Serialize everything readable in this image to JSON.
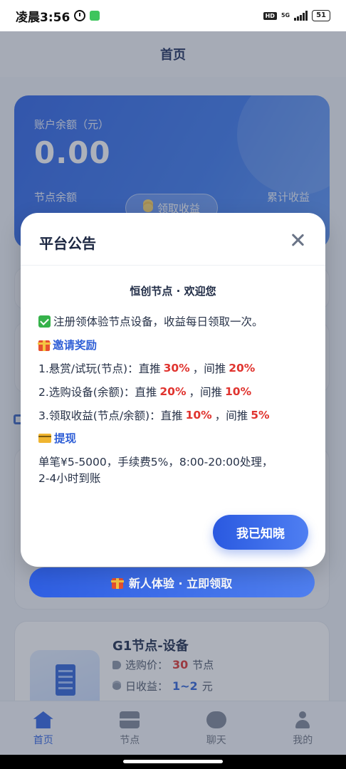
{
  "status_bar": {
    "time": "凌晨3:56",
    "hd": "HD",
    "network": "5G",
    "battery": "51"
  },
  "header": {
    "title": "首页"
  },
  "balance_card": {
    "account_label": "账户余额（元）",
    "account_value": "0.00",
    "node_balance_label": "节点余额",
    "claim_button": "领取收益",
    "total_income_label": "累计收益"
  },
  "newbie_button": "新人体验 · 立即领取",
  "product": {
    "name": "G1节点-设备",
    "price_label": "选购价：",
    "price_value": "30",
    "price_unit": "节点",
    "income_label": "日收益：",
    "income_value": "1~2",
    "income_unit": "元"
  },
  "bottom_nav": [
    {
      "label": "首页",
      "icon": "home-icon"
    },
    {
      "label": "节点",
      "icon": "server-icon"
    },
    {
      "label": "聊天",
      "icon": "chat-icon"
    },
    {
      "label": "我的",
      "icon": "user-icon"
    }
  ],
  "modal": {
    "title": "平台公告",
    "subtitle": "恒创节点 · 欢迎您",
    "notice": "注册领体验节点设备，收益每日领取一次。",
    "invite_title": "邀请奖励",
    "rules": [
      {
        "text": "1.悬赏/试玩(节点)：直推",
        "direct": "30%",
        "sep": "，间推",
        "indirect": "20%"
      },
      {
        "text": "2.选购设备(余额)：直推",
        "direct": "20%",
        "sep": "，间推",
        "indirect": "10%"
      },
      {
        "text": "3.领取收益(节点/余额)：直推",
        "direct": "10%",
        "sep": "，间推",
        "indirect": "5%"
      }
    ],
    "withdraw_title": "提现",
    "withdraw_line1": "单笔¥5-5000，手续费5%，8:00-20:00处理，",
    "withdraw_line2": "2-4小时到账",
    "ack_button": "我已知晓"
  }
}
